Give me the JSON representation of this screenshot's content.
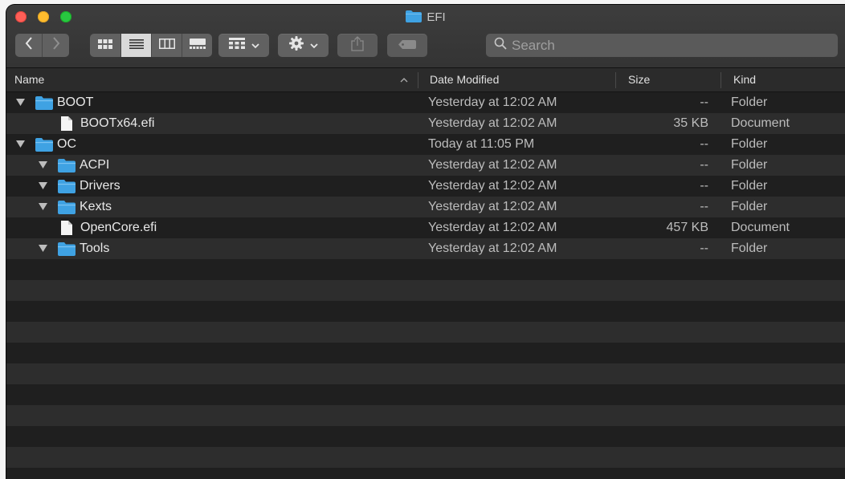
{
  "window": {
    "title": "EFI",
    "title_icon": "folder-icon"
  },
  "toolbar": {
    "back_icon": "chevron-left-icon",
    "forward_icon": "chevron-right-icon",
    "view_modes": [
      "icon-view-icon",
      "list-view-icon",
      "column-view-icon",
      "gallery-view-icon"
    ],
    "active_view": "list-view-icon",
    "group_icon": "group-by-icon",
    "action_icon": "gear-icon",
    "share_icon": "share-icon",
    "tag_icon": "tag-icon"
  },
  "search": {
    "placeholder": "Search",
    "value": ""
  },
  "columns": {
    "name": "Name",
    "date": "Date Modified",
    "size": "Size",
    "kind": "Kind",
    "sort_indicator": "^"
  },
  "rows": [
    {
      "name": "BOOT",
      "date": "Yesterday at 12:02 AM",
      "size": "--",
      "kind": "Folder",
      "type": "folder",
      "level": 0,
      "expanded": true
    },
    {
      "name": "BOOTx64.efi",
      "date": "Yesterday at 12:02 AM",
      "size": "35 KB",
      "kind": "Document",
      "type": "file",
      "level": 1,
      "expanded": false
    },
    {
      "name": "OC",
      "date": "Today at 11:05 PM",
      "size": "--",
      "kind": "Folder",
      "type": "folder",
      "level": 0,
      "expanded": true
    },
    {
      "name": "ACPI",
      "date": "Yesterday at 12:02 AM",
      "size": "--",
      "kind": "Folder",
      "type": "folder",
      "level": 1,
      "expanded": true
    },
    {
      "name": "Drivers",
      "date": "Yesterday at 12:02 AM",
      "size": "--",
      "kind": "Folder",
      "type": "folder",
      "level": 1,
      "expanded": true
    },
    {
      "name": "Kexts",
      "date": "Yesterday at 12:02 AM",
      "size": "--",
      "kind": "Folder",
      "type": "folder",
      "level": 1,
      "expanded": true
    },
    {
      "name": "OpenCore.efi",
      "date": "Yesterday at 12:02 AM",
      "size": "457 KB",
      "kind": "Document",
      "type": "file",
      "level": 1,
      "expanded": false
    },
    {
      "name": "Tools",
      "date": "Yesterday at 12:02 AM",
      "size": "--",
      "kind": "Folder",
      "type": "folder",
      "level": 1,
      "expanded": true
    }
  ],
  "colors": {
    "folder": "#3fa2e3",
    "row_even": "#1f1f1f",
    "row_odd": "#2d2d2d",
    "text": "#e8e8e8"
  }
}
